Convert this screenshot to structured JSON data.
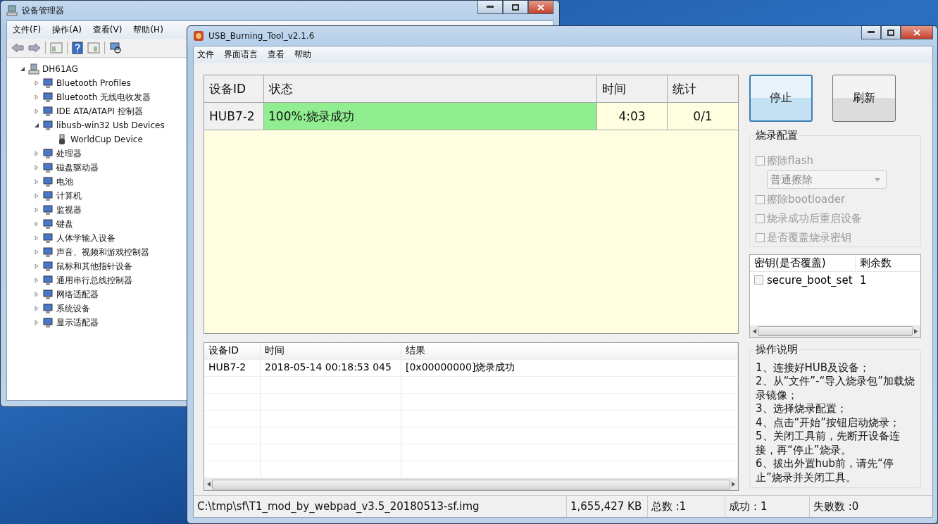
{
  "device_manager": {
    "title": "设备管理器",
    "menu": [
      "文件(F)",
      "操作(A)",
      "查看(V)",
      "帮助(H)"
    ],
    "tree": {
      "label": "DH61AG",
      "expanded": true,
      "children": [
        {
          "label": "Bluetooth Profiles",
          "expanded": false
        },
        {
          "label": "Bluetooth 无线电收发器",
          "expanded": false
        },
        {
          "label": "IDE ATA/ATAPI 控制器",
          "expanded": false
        },
        {
          "label": "libusb-win32 Usb Devices",
          "expanded": true,
          "children": [
            {
              "label": "WorldCup Device"
            }
          ]
        },
        {
          "label": "处理器",
          "expanded": false
        },
        {
          "label": "磁盘驱动器",
          "expanded": false
        },
        {
          "label": "电池",
          "expanded": false
        },
        {
          "label": "计算机",
          "expanded": false
        },
        {
          "label": "监视器",
          "expanded": false
        },
        {
          "label": "键盘",
          "expanded": false
        },
        {
          "label": "人体学输入设备",
          "expanded": false
        },
        {
          "label": "声音、视频和游戏控制器",
          "expanded": false
        },
        {
          "label": "鼠标和其他指针设备",
          "expanded": false
        },
        {
          "label": "通用串行总线控制器",
          "expanded": false
        },
        {
          "label": "网络适配器",
          "expanded": false
        },
        {
          "label": "系统设备",
          "expanded": false
        },
        {
          "label": "显示适配器",
          "expanded": false
        }
      ]
    }
  },
  "burning_tool": {
    "title": "USB_Burning_Tool_v2.1.6",
    "menu": [
      "文件",
      "界面语言",
      "查看",
      "帮助"
    ],
    "device_table": {
      "columns": [
        "设备ID",
        "状态",
        "时间",
        "统计"
      ],
      "rows": [
        {
          "device_id": "HUB7-2",
          "status": "100%:烧录成功",
          "level": 1,
          "time": "4:03",
          "count": "0/1"
        }
      ]
    },
    "buttons": [
      {
        "label": "停止",
        "focused": true
      },
      {
        "label": "刷新",
        "focused": false
      }
    ],
    "config": {
      "title": "烧录配置",
      "options": [
        {
          "kind": "checkbox",
          "label": "擦除flash",
          "checked": false,
          "disabled": true
        },
        {
          "kind": "dropdown",
          "value": "普通擦除",
          "disabled": true
        },
        {
          "kind": "checkbox",
          "label": "擦除bootloader",
          "checked": false,
          "disabled": true
        },
        {
          "kind": "checkbox",
          "label": "烧录成功后重启设备",
          "checked": false,
          "disabled": true
        },
        {
          "kind": "checkbox",
          "label": "是否覆盖烧录密钥",
          "checked": false,
          "disabled": true
        }
      ]
    },
    "key_table": {
      "columns": [
        "密钥(是否覆盖)",
        "剩余数"
      ],
      "rows": [
        {
          "key": "secure_boot_set",
          "checked": false,
          "remaining": "1"
        }
      ]
    },
    "instructions": {
      "title": "操作说明",
      "lines": [
        "1、连接好HUB及设备；",
        "2、从“文件”-“导入烧录包”加载烧录镜像；",
        "3、选择烧录配置；",
        "4、点击“开始”按钮启动烧录；",
        "5、关闭工具前，先断开设备连接，再“停止”烧录。",
        "6、拔出外置hub前，请先“停止”烧录并关闭工具。"
      ]
    },
    "log_table": {
      "columns": [
        "设备ID",
        "时间",
        "结果"
      ],
      "rows": [
        {
          "device_id": "HUB7-2",
          "time": "2018-05-14 00:18:53 045",
          "result": "[0x00000000]烧录成功"
        }
      ]
    },
    "status_bar": {
      "path": "C:\\tmp\\sf\\T1_mod_by_webpad_v3.5_20180513-sf.img",
      "size": "1,655,427 KB",
      "total": "总数 :1",
      "success": "成功：1",
      "failed": "失败数 :0"
    }
  }
}
